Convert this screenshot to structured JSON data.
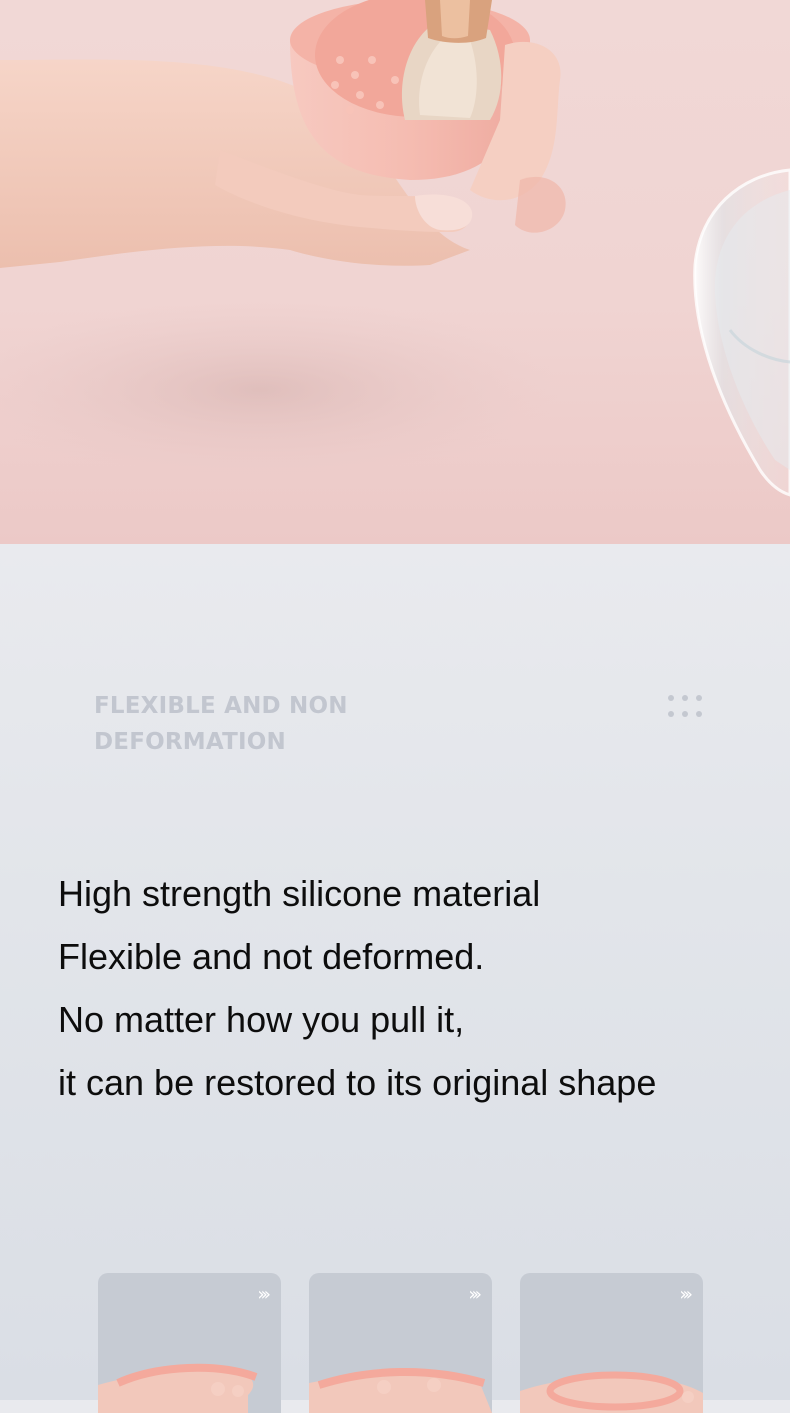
{
  "hero": {
    "image": "product-photo-hand-holding-brush-cleaning-bowl"
  },
  "section": {
    "title_line1": "FLEXIBLE AND NON",
    "title_line2": "DEFORMATION"
  },
  "description": {
    "lines": [
      "High strength silicone material",
      "Flexible and not deformed.",
      "No matter how you pull it,",
      "it can be restored to its original shape"
    ]
  },
  "thumbnails": [
    {
      "arrow": "›››"
    },
    {
      "arrow": "›››"
    },
    {
      "arrow": "›››"
    }
  ],
  "colors": {
    "hero_background": "#f0d4d2",
    "bowl_pink": "#f4b8ad",
    "page_background": "#e4e7ec",
    "title_gray": "#c2c6cf",
    "text_black": "#0d0d0d",
    "thumbnail_gray": "#c6cbd3"
  }
}
